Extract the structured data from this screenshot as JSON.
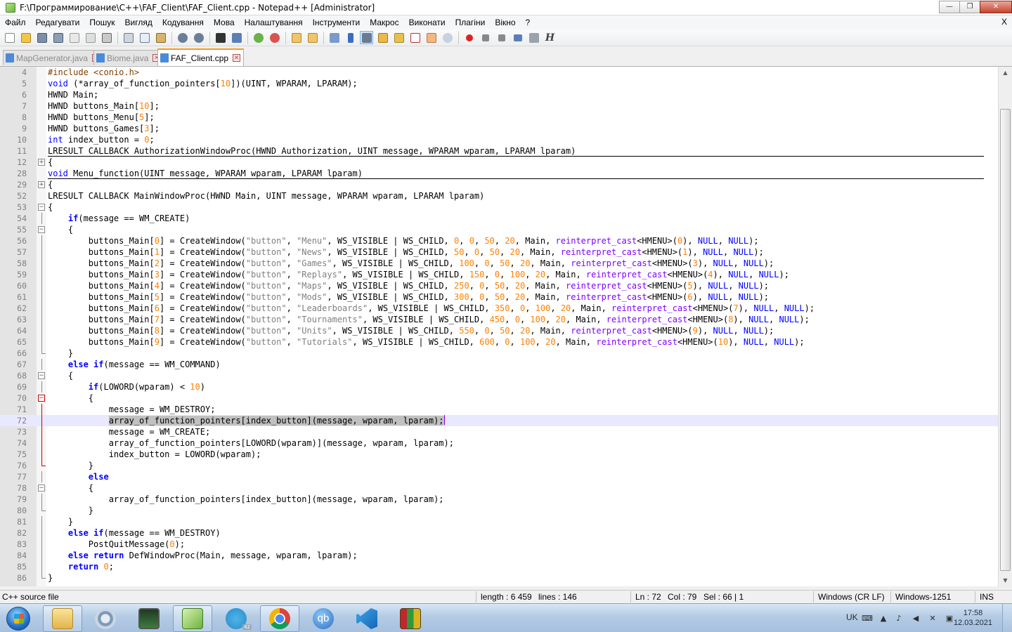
{
  "window": {
    "title": "F:\\Программирование\\C++\\FAF_Client\\FAF_Client.cpp - Notepad++ [Administrator]",
    "btn_min": "—",
    "btn_max": "❐",
    "btn_close": "✕"
  },
  "menu": {
    "items": [
      "Файл",
      "Редагувати",
      "Пошук",
      "Вигляд",
      "Кодування",
      "Мова",
      "Налаштування",
      "Інструменти",
      "Макрос",
      "Виконати",
      "Плагіни",
      "Вікно",
      "?"
    ],
    "close": "X"
  },
  "toolbar": {
    "h_label": "H",
    "icons": [
      "new-file-icon",
      "open-file-icon",
      "save-icon",
      "save-all-icon",
      "close-icon",
      "close-all-icon",
      "print-icon",
      "cut-icon",
      "copy-icon",
      "paste-icon",
      "undo-icon",
      "redo-icon",
      "find-icon",
      "replace-icon",
      "zoom-in-icon",
      "zoom-out-icon",
      "sync-vertical-icon",
      "sync-horizontal-icon",
      "word-wrap-icon",
      "show-all-chars-icon",
      "indent-guide-icon",
      "udl-icon",
      "doc-map-icon",
      "function-list-icon",
      "folder-workspace-icon",
      "monitoring-icon",
      "record-macro-icon",
      "stop-record-icon",
      "play-macro-icon",
      "run-macro-multiple-icon",
      "save-macro-icon"
    ]
  },
  "tabs": [
    {
      "label": "MapGenerator.java",
      "close": "✕",
      "active": false
    },
    {
      "label": "Biome.java",
      "close": "✕",
      "active": false
    },
    {
      "label": "FAF_Client.cpp",
      "close": "✕",
      "active": true
    }
  ],
  "editor": {
    "line_numbers": [
      "4",
      "5",
      "6",
      "7",
      "8",
      "9",
      "10",
      "11",
      "12",
      "28",
      "29",
      "52",
      "53",
      "54",
      "55",
      "56",
      "57",
      "58",
      "59",
      "60",
      "61",
      "62",
      "63",
      "64",
      "65",
      "66",
      "67",
      "68",
      "69",
      "70",
      "71",
      "72",
      "73",
      "74",
      "75",
      "76",
      "77",
      "78",
      "79",
      "80",
      "81",
      "82",
      "83",
      "84",
      "85",
      "86"
    ],
    "fold_markers": {
      "12": "+",
      "29": "+",
      "53": "−",
      "55": "−",
      "68": "−",
      "70": "−",
      "78": "−"
    },
    "current_line": "72"
  },
  "status": {
    "file_type": "C++ source file",
    "length": "length : 6 459",
    "lines": "lines : 146",
    "ln": "Ln : 72",
    "col": "Col : 79",
    "sel": "Sel : 66 | 1",
    "eol": "Windows (CR LF)",
    "encoding": "Windows-1251",
    "mode": "INS"
  },
  "taskbar": {
    "telegram_badge": "42",
    "qb_label": "qb",
    "lang": "UK",
    "time": "17:58",
    "date": "12.03.2021"
  },
  "colors": {
    "keyword": "#0000ff",
    "type": "#8000ff",
    "number": "#ff8000",
    "string": "#808080",
    "preprocessor": "#804000",
    "tab_accent": "#fa9a1e",
    "current_line": "#e8e8ff"
  }
}
